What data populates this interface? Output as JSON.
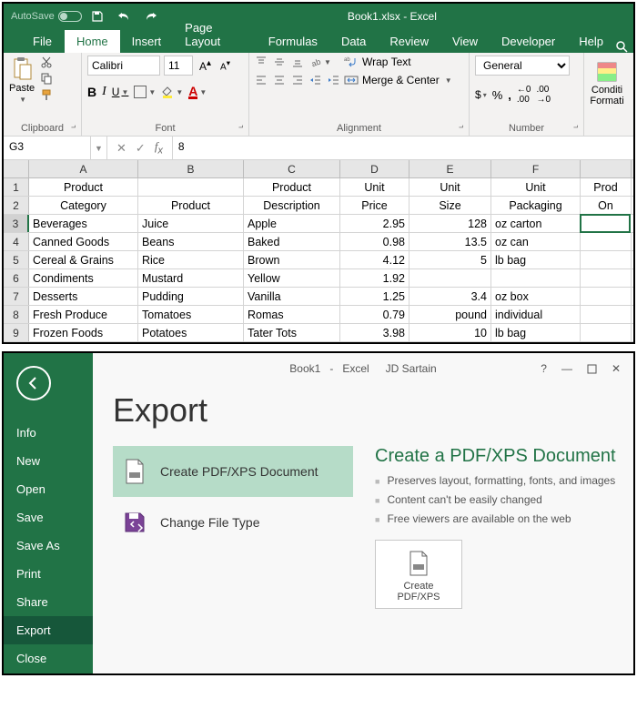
{
  "titlebar": {
    "autosave_label": "AutoSave",
    "autosave_state": "Off",
    "title": "Book1.xlsx - Excel"
  },
  "tabs": {
    "file": "File",
    "home": "Home",
    "insert": "Insert",
    "page_layout": "Page Layout",
    "formulas": "Formulas",
    "data": "Data",
    "review": "Review",
    "view": "View",
    "developer": "Developer",
    "help": "Help"
  },
  "ribbon": {
    "clipboard": {
      "paste": "Paste",
      "label": "Clipboard"
    },
    "font": {
      "name": "Calibri",
      "size": "11",
      "label": "Font"
    },
    "alignment": {
      "wrap": "Wrap Text",
      "merge": "Merge & Center",
      "label": "Alignment"
    },
    "number": {
      "format": "General",
      "label": "Number"
    },
    "cond": {
      "line1": "Conditi",
      "line2": "Formati"
    }
  },
  "formula_bar": {
    "name_box": "G3",
    "value": "8"
  },
  "columns": [
    "A",
    "B",
    "C",
    "D",
    "E",
    "F"
  ],
  "header_row1": [
    "Product",
    "",
    "Product",
    "Unit",
    "Unit",
    "Unit",
    "Prod"
  ],
  "header_row2": [
    "Category",
    "Product",
    "Description",
    "Price",
    "Size",
    "Packaging",
    "On "
  ],
  "rows": [
    {
      "n": "3",
      "c": [
        "Beverages",
        "Juice",
        "Apple",
        "2.95",
        "128",
        "oz carton",
        ""
      ]
    },
    {
      "n": "4",
      "c": [
        "Canned Goods",
        "Beans",
        "Baked",
        "0.98",
        "13.5",
        "oz can",
        ""
      ]
    },
    {
      "n": "5",
      "c": [
        "Cereal & Grains",
        "Rice",
        "Brown",
        "4.12",
        "5",
        "lb bag",
        ""
      ]
    },
    {
      "n": "6",
      "c": [
        "Condiments",
        "Mustard",
        "Yellow",
        "1.92",
        "",
        "",
        ""
      ]
    },
    {
      "n": "7",
      "c": [
        "Desserts",
        "Pudding",
        "Vanilla",
        "1.25",
        "3.4",
        "oz box",
        ""
      ]
    },
    {
      "n": "8",
      "c": [
        "Fresh Produce",
        "Tomatoes",
        "Romas",
        "0.79",
        "pound",
        "individual",
        ""
      ]
    },
    {
      "n": "9",
      "c": [
        "Frozen Foods",
        "Potatoes",
        "Tater Tots",
        "3.98",
        "10",
        "lb bag",
        ""
      ]
    }
  ],
  "backstage": {
    "title_doc": "Book1",
    "title_app": "Excel",
    "title_user": "JD Sartain",
    "menu": {
      "info": "Info",
      "new": "New",
      "open": "Open",
      "save": "Save",
      "saveas": "Save As",
      "print": "Print",
      "share": "Share",
      "export": "Export",
      "close": "Close"
    },
    "heading": "Export",
    "opt1": "Create PDF/XPS Document",
    "opt2": "Change File Type",
    "detail_h": "Create a PDF/XPS Document",
    "detail_1": "Preserves layout, formatting, fonts, and images",
    "detail_2": "Content can't be easily changed",
    "detail_3": "Free viewers are available on the web",
    "create_btn": "Create PDF/XPS"
  }
}
